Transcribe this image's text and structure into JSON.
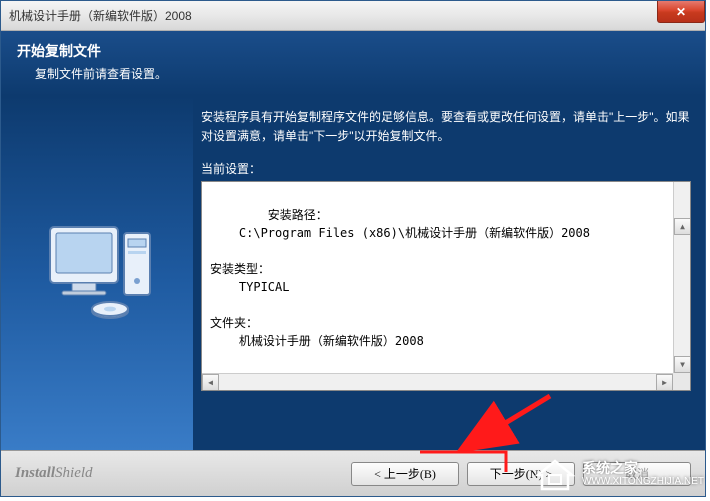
{
  "window": {
    "title": "机械设计手册（新编软件版）2008"
  },
  "header": {
    "title": "开始复制文件",
    "subtitle": "复制文件前请查看设置。"
  },
  "content": {
    "instructions": "安装程序具有开始复制程序文件的足够信息。要查看或更改任何设置，请单击\"上一步\"。如果对设置满意，请单击\"下一步\"以开始复制文件。",
    "settingsLabel": "当前设置：",
    "settingsText": "安装路径：\n    C:\\Program Files (x86)\\机械设计手册（新编软件版）2008\n\n安装类型：\n    TYPICAL\n\n文件夹：\n    机械设计手册（新编软件版）2008"
  },
  "footer": {
    "brand1": "Install",
    "brand2": "Shield",
    "back": "< 上一步(B)",
    "next": "下一步(N) >",
    "cancel": "取消"
  },
  "watermark": {
    "title": "系统之家",
    "url": "WWW.XITONGZHIJIA.NET"
  }
}
